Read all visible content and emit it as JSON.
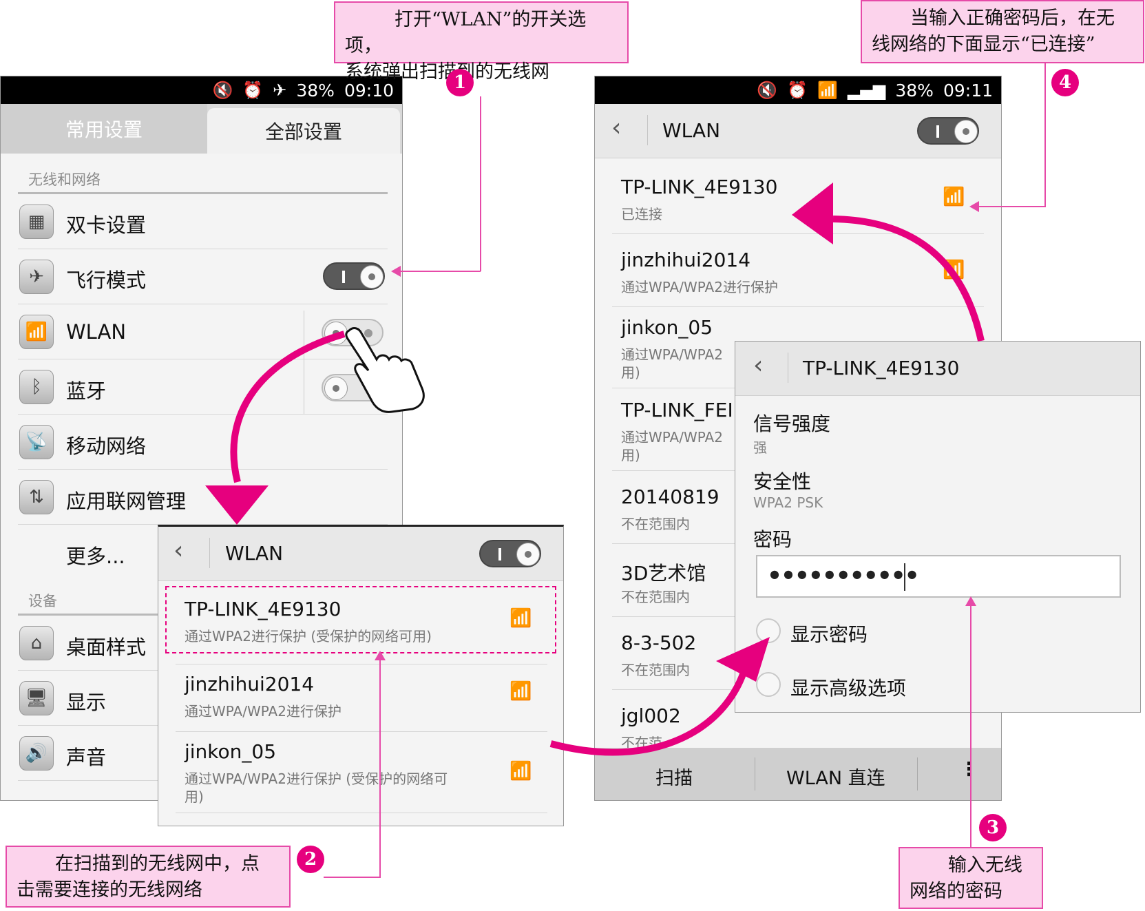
{
  "callouts": {
    "c1": {
      "line1": "打开“WLAN”的开关选项，",
      "line2": "系统弹出扫描到的无线网"
    },
    "c2": {
      "line1": "在扫描到的无线网中，点",
      "line2": "击需要连接的无线网络"
    },
    "c3": {
      "line1": "输入无线",
      "line2": "网络的密码"
    },
    "c4": {
      "line1": "当输入正确密码后，在无",
      "line2": "线网络的下面显示“已连接”"
    }
  },
  "badges": [
    "1",
    "2",
    "3",
    "4"
  ],
  "phone1": {
    "status": {
      "battery": "38%",
      "time": "09:10"
    },
    "tabs": {
      "common": "常用设置",
      "all": "全部设置"
    },
    "section_wireless": "无线和网络",
    "rows": {
      "dual_sim": "双卡设置",
      "airplane": "飞行模式",
      "wlan": "WLAN",
      "bluetooth": "蓝牙",
      "mobile_network": "移动网络",
      "app_network": "应用联网管理",
      "more": "更多..."
    },
    "section_device": "设备",
    "device_rows": {
      "desktop_style": "桌面样式",
      "display": "显示",
      "sound": "声音"
    }
  },
  "phone2": {
    "title": "WLAN",
    "networks": [
      {
        "name": "TP-LINK_4E9130",
        "sub": "通过WPA2进行保护 (受保护的网络可用)"
      },
      {
        "name": "jinzhihui2014",
        "sub": "通过WPA/WPA2进行保护"
      },
      {
        "name": "jinkon_05",
        "sub": "通过WPA/WPA2进行保护 (受保护的网络可",
        "sub2": "用)"
      }
    ]
  },
  "phone3": {
    "status": {
      "battery": "38%",
      "time": "09:11"
    },
    "title": "WLAN",
    "networks": [
      {
        "name": "TP-LINK_4E9130",
        "sub": "已连接"
      },
      {
        "name": "jinzhihui2014",
        "sub": "通过WPA/WPA2进行保护"
      },
      {
        "name": "jinkon_05",
        "sub": "通过WPA/WPA2",
        "sub2": "用)"
      },
      {
        "name": "TP-LINK_FEI",
        "sub": "通过WPA/WPA2",
        "sub2": "用)"
      },
      {
        "name": "20140819",
        "sub": "不在范围内"
      },
      {
        "name": "3D艺术馆",
        "sub": "不在范围内"
      },
      {
        "name": "8-3-502",
        "sub": "不在范围内"
      },
      {
        "name": "jgl002",
        "sub": "不在范"
      }
    ],
    "bottom": {
      "scan": "扫描",
      "direct": "WLAN 直连"
    }
  },
  "dialog": {
    "title": "TP-LINK_4E9130",
    "signal_label": "信号强度",
    "signal_value": "强",
    "security_label": "安全性",
    "security_value": "WPA2 PSK",
    "password_label": "密码",
    "password_value": "●●●●●●●●●●●",
    "show_password": "显示密码",
    "show_advanced": "显示高级选项"
  },
  "colors": {
    "accent": "#e6007e",
    "callout_bg": "#fcd3ec",
    "callout_border": "#e64aa8"
  }
}
